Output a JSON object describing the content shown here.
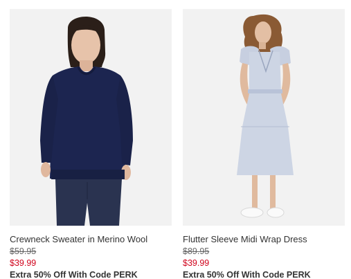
{
  "products": [
    {
      "name": "Crewneck Sweater in Merino Wool",
      "original_price": "$59.95",
      "sale_price": "$39.99",
      "promo": "Extra 50% Off With Code PERK",
      "image": "model-navy-sweater-jeans"
    },
    {
      "name": "Flutter Sleeve Midi Wrap Dress",
      "original_price": "$89.95",
      "sale_price": "$39.99",
      "promo": "Extra 50% Off With Code PERK",
      "image": "model-light-blue-wrap-dress-sneakers"
    }
  ],
  "colors": {
    "sale_red": "#d0021b",
    "text": "#333333",
    "strike_grey": "#666666",
    "photo_bg": "#f3f3f3"
  }
}
